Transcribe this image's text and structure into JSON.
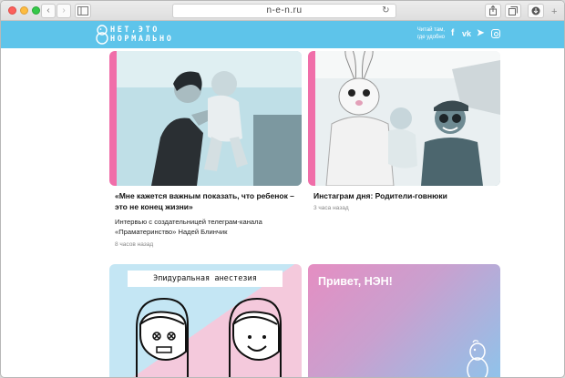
{
  "browser": {
    "url": "n-e-n.ru",
    "back_icon": "chevron-left-icon",
    "forward_icon": "chevron-right-icon",
    "sidebar_icon": "sidebar-icon",
    "reload_icon": "reload-icon",
    "share_icon": "share-icon",
    "tabs_icon": "tabs-icon",
    "download_icon": "download-icon",
    "new_tab_glyph": "+"
  },
  "header": {
    "logo_line1": "НЕТ,ЭТО",
    "logo_line2": "НОРМАЛЬНО",
    "tagline": "Читай там, где удобно",
    "social": {
      "facebook": "f",
      "vk": "vk",
      "telegram": "➤",
      "instagram": "instagram-icon"
    },
    "bg_color": "#5ec4ea"
  },
  "articles": [
    {
      "title": "«Мне кажется важным показать, что ребенок – это не конец жизни»",
      "subtitle": "Интервью с создательницей телеграм-канала «Праматеринство» Надей Блинчик",
      "time": "8 часов назад"
    },
    {
      "title": "Инстаграм дня: Родители-говнюки",
      "subtitle": "",
      "time": "3 часа назад"
    }
  ],
  "tiles": [
    {
      "banner": "Эпидуральная анестезия"
    },
    {
      "title": "Привет, НЭН!"
    }
  ],
  "colors": {
    "accent_pink": "#f06ea9",
    "accent_blue": "#5ec4ea"
  }
}
